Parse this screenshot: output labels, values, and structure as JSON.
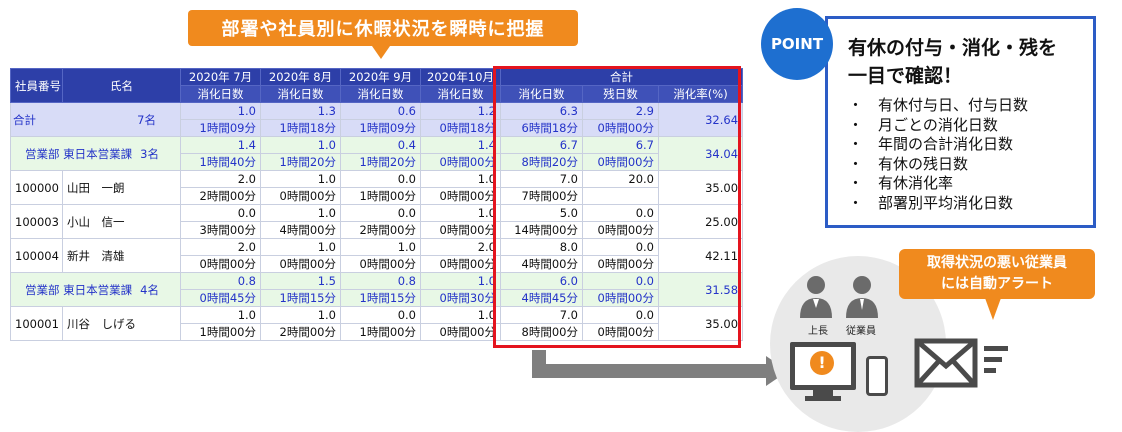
{
  "callout_top": "部署や社員別に休暇状況を瞬時に把握",
  "table": {
    "header": {
      "col_id": "社員番号",
      "col_name": "氏名",
      "months": [
        "2020年 7月",
        "2020年 8月",
        "2020年 9月",
        "2020年10月"
      ],
      "total": "合計",
      "sub_used": "消化日数",
      "sub_remaining": "残日数",
      "sub_rate": "消化率(%)"
    },
    "rows": [
      {
        "kind": "total",
        "label": "合計",
        "count": "7名",
        "days": [
          "1.0",
          "1.3",
          "0.6",
          "1.2"
        ],
        "times": [
          "1時間09分",
          "1時間18分",
          "1時間09分",
          "0時間18分"
        ],
        "used": "6.3",
        "used_time": "6時間18分",
        "remaining": "2.9",
        "remaining_time": "0時間00分",
        "rate": "32.64"
      },
      {
        "kind": "dept",
        "label": "営業部 東日本営業課",
        "count": "3名",
        "days": [
          "1.4",
          "1.0",
          "0.4",
          "1.4"
        ],
        "times": [
          "1時間40分",
          "1時間20分",
          "1時間20分",
          "0時間00分"
        ],
        "used": "6.7",
        "used_time": "8時間20分",
        "remaining": "6.7",
        "remaining_time": "0時間00分",
        "rate": "34.04"
      },
      {
        "kind": "emp",
        "id": "100000",
        "label": "山田　一朗",
        "days": [
          "2.0",
          "1.0",
          "0.0",
          "1.0"
        ],
        "times": [
          "2時間00分",
          "0時間00分",
          "1時間00分",
          "0時間00分"
        ],
        "used": "7.0",
        "used_time": "7時間00分",
        "remaining": "20.0",
        "remaining_time": "",
        "rate": "35.00"
      },
      {
        "kind": "emp",
        "id": "100003",
        "label": "小山　信一",
        "days": [
          "0.0",
          "1.0",
          "0.0",
          "1.0"
        ],
        "times": [
          "3時間00分",
          "4時間00分",
          "2時間00分",
          "0時間00分"
        ],
        "used": "5.0",
        "used_time": "14時間00分",
        "remaining": "0.0",
        "remaining_time": "0時間00分",
        "rate": "25.00"
      },
      {
        "kind": "emp",
        "id": "100004",
        "label": "新井　清雄",
        "days": [
          "2.0",
          "1.0",
          "1.0",
          "2.0"
        ],
        "times": [
          "0時間00分",
          "0時間00分",
          "0時間00分",
          "0時間00分"
        ],
        "used": "8.0",
        "used_time": "4時間00分",
        "remaining": "0.0",
        "remaining_time": "0時間00分",
        "rate": "42.11"
      },
      {
        "kind": "dept",
        "label": "営業部 東日本営業課",
        "count": "4名",
        "days": [
          "0.8",
          "1.5",
          "0.8",
          "1.0"
        ],
        "times": [
          "0時間45分",
          "1時間15分",
          "1時間15分",
          "0時間30分"
        ],
        "used": "6.0",
        "used_time": "4時間45分",
        "remaining": "0.0",
        "remaining_time": "0時間00分",
        "rate": "31.58"
      },
      {
        "kind": "emp",
        "id": "100001",
        "label": "川谷　しげる",
        "days": [
          "1.0",
          "1.0",
          "0.0",
          "1.0"
        ],
        "times": [
          "1時間00分",
          "2時間00分",
          "1時間00分",
          "0時間00分"
        ],
        "used": "7.0",
        "used_time": "8時間00分",
        "remaining": "0.0",
        "remaining_time": "0時間00分",
        "rate": "35.00"
      }
    ]
  },
  "point": {
    "badge": "POINT",
    "title_line1": "有休の付与・消化・残を",
    "title_line2": "一目で確認！",
    "bullet": "・",
    "items": [
      "有休付与日、付与日数",
      "月ごとの消化日数",
      "年間の合計消化日数",
      "有休の残日数",
      "有休消化率",
      "部署別平均消化日数"
    ]
  },
  "alert": {
    "line1": "取得状況の悪い従業員",
    "line2": "には自動アラート"
  },
  "people": {
    "boss": "上長",
    "employee": "従業員"
  },
  "icons": [
    "person-boss-icon",
    "person-employee-icon",
    "monitor-icon",
    "warning-icon",
    "smartphone-icon",
    "envelope-icon"
  ],
  "colors": {
    "orange": "#f08a1e",
    "header_blue": "#2d3fa8",
    "point_blue": "#1e6fd0",
    "red_box": "#e4141e"
  }
}
